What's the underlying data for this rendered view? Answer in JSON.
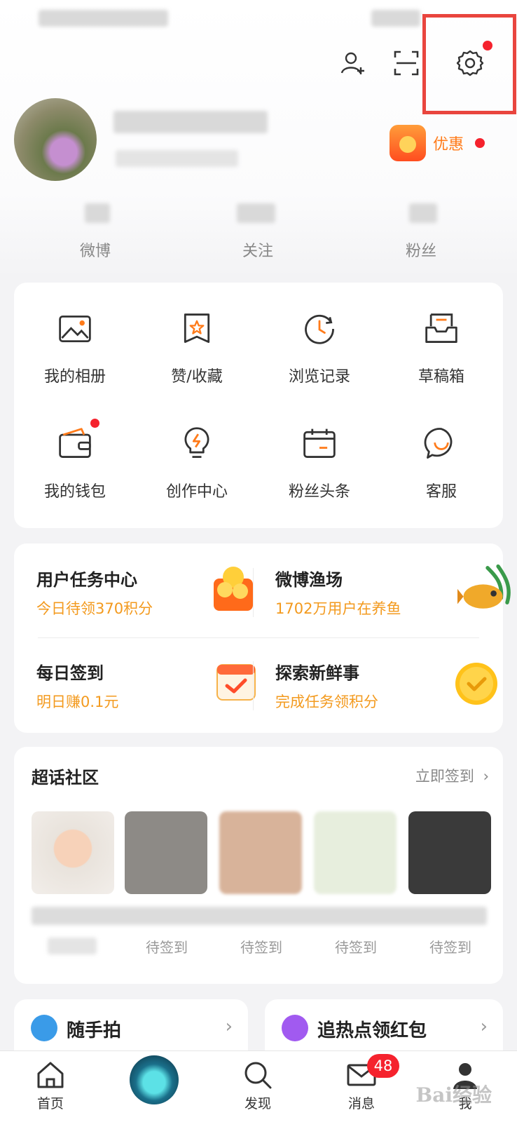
{
  "header": {
    "add_friend_icon": "person-add-icon",
    "scan_icon": "scan-icon",
    "settings_icon": "gear-icon",
    "highlight_color": "#e9453e"
  },
  "profile": {
    "promo_label": "优惠"
  },
  "stats": [
    {
      "label": "微博"
    },
    {
      "label": "关注"
    },
    {
      "label": "粉丝"
    }
  ],
  "grid": [
    {
      "label": "我的相册",
      "icon": "photo-icon"
    },
    {
      "label": "赞/收藏",
      "icon": "favorite-icon"
    },
    {
      "label": "浏览记录",
      "icon": "history-icon"
    },
    {
      "label": "草稿箱",
      "icon": "draft-icon"
    },
    {
      "label": "我的钱包",
      "icon": "wallet-icon"
    },
    {
      "label": "创作中心",
      "icon": "bulb-icon"
    },
    {
      "label": "粉丝头条",
      "icon": "calendar-icon"
    },
    {
      "label": "客服",
      "icon": "chat-icon"
    }
  ],
  "tasks": [
    {
      "title": "用户任务中心",
      "sub": "今日待领370积分"
    },
    {
      "title": "微博渔场",
      "sub": "1702万用户在养鱼"
    },
    {
      "title": "每日签到",
      "sub": "明日赚0.1元"
    },
    {
      "title": "探索新鲜事",
      "sub": "完成任务领积分"
    }
  ],
  "super_topic": {
    "title": "超话社区",
    "link": "立即签到",
    "statuses": [
      "待签到",
      "待签到",
      "待签到",
      "待签到"
    ]
  },
  "mini_cards": [
    {
      "label": "随手拍",
      "chevron": "›"
    },
    {
      "label": "追热点领红包",
      "chevron": "›"
    }
  ],
  "tabbar": {
    "home": "首页",
    "discover": "发现",
    "messages": "消息",
    "messages_badge": "48",
    "me": "我"
  },
  "accent": "#f39a1e",
  "badge_color": "#f5222d"
}
